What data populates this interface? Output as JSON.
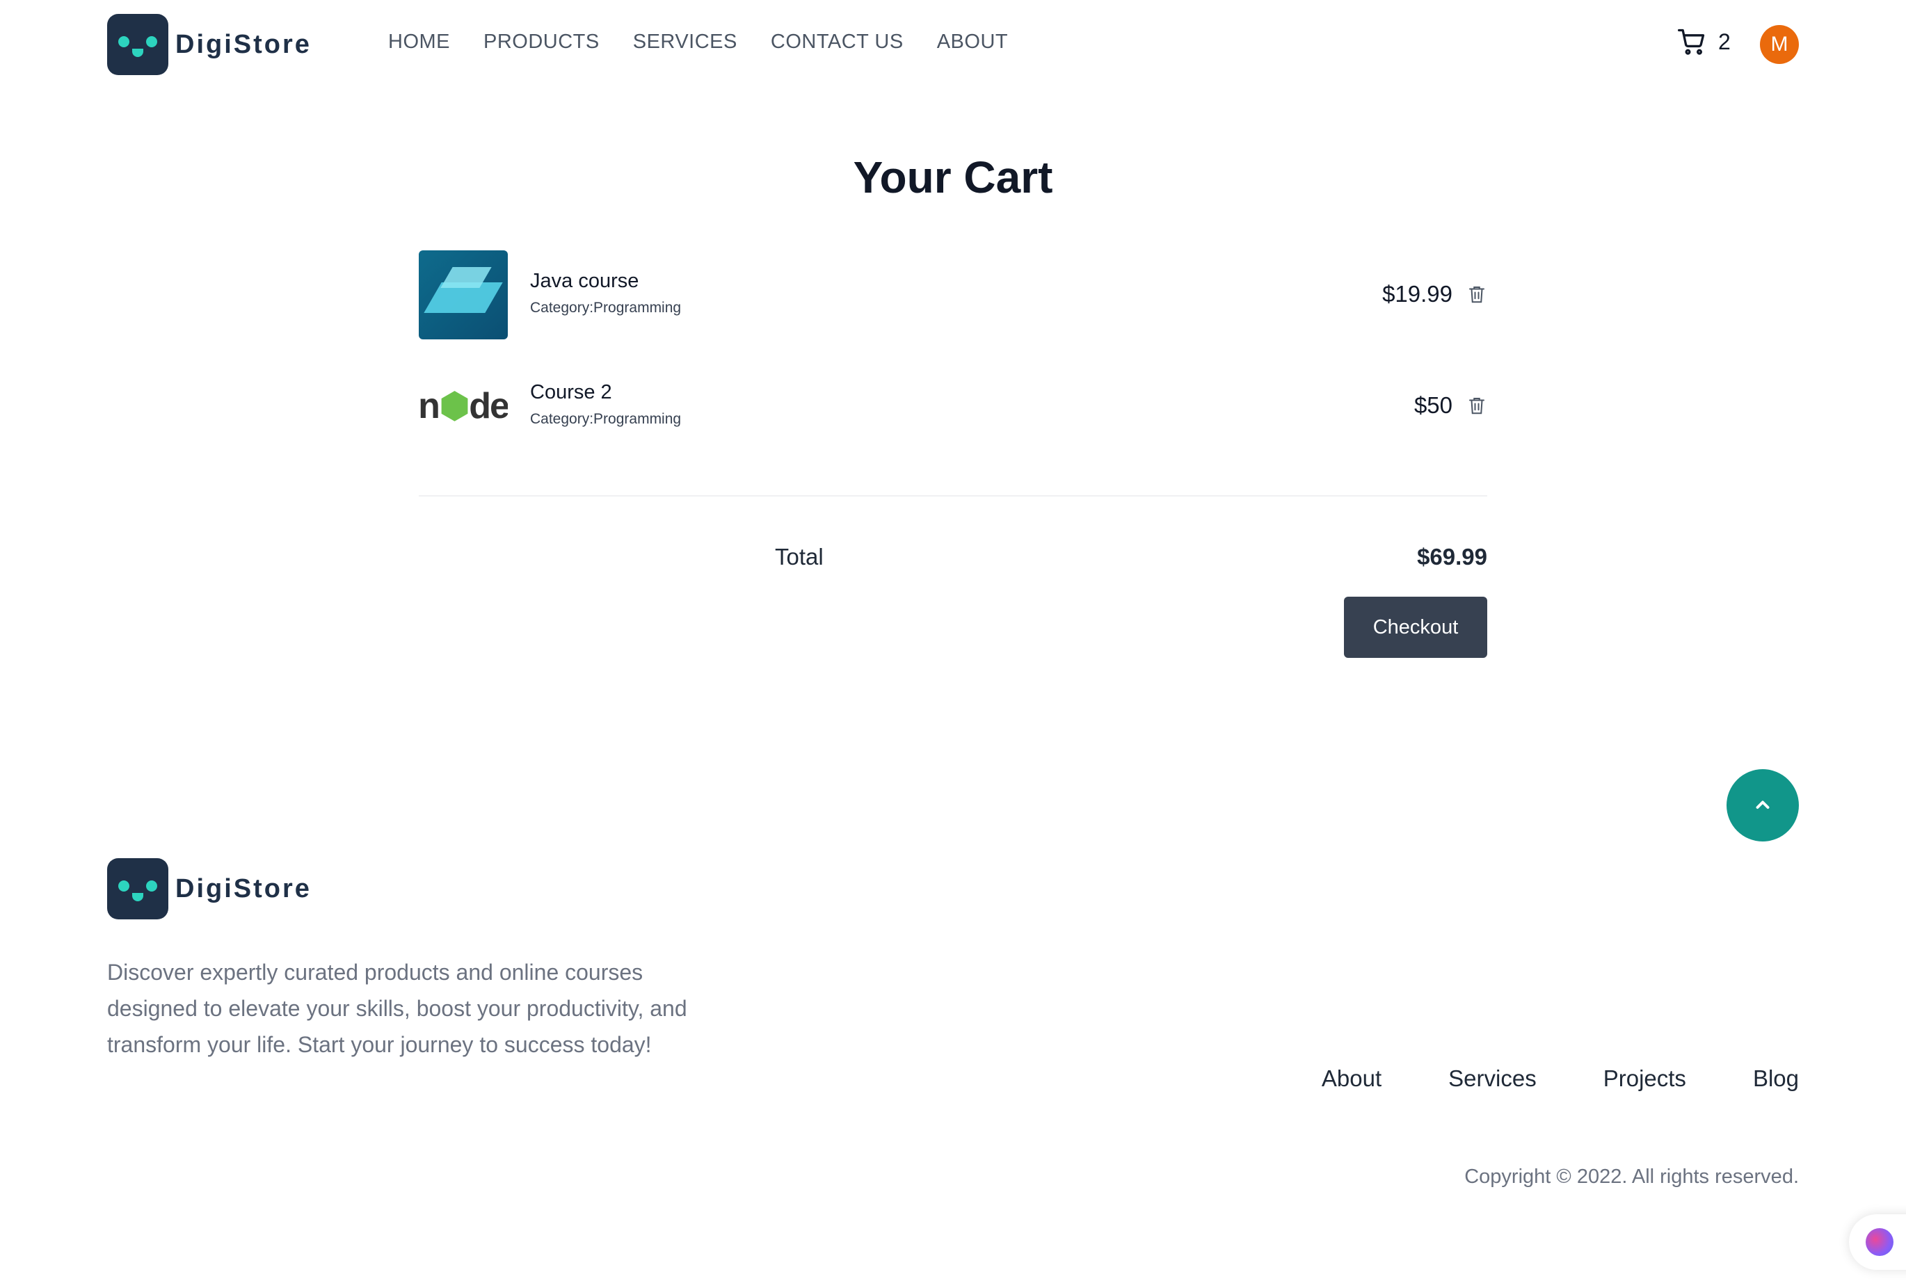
{
  "brand": {
    "name": "DigiStore",
    "accent": "#2dd4bf",
    "dark": "#1f3047"
  },
  "nav": {
    "items": [
      "HOME",
      "PRODUCTS",
      "SERVICES",
      "CONTACT US",
      "ABOUT"
    ]
  },
  "cart_indicator": {
    "count": "2"
  },
  "user": {
    "initial": "M",
    "color": "#ea6a0c"
  },
  "page": {
    "title": "Your Cart"
  },
  "cart": {
    "items": [
      {
        "name": "Java course",
        "category": "Category:Programming",
        "price": "$19.99",
        "thumbnail": "java-isometric-illustration"
      },
      {
        "name": "Course 2",
        "category": "Category:Programming",
        "price": "$50",
        "thumbnail": "nodejs-logo"
      }
    ],
    "total_label": "Total",
    "total_value": "$69.99",
    "checkout_label": "Checkout"
  },
  "scroll_top": {
    "icon": "chevron-up-icon",
    "color": "#11968a"
  },
  "footer": {
    "description": "Discover expertly curated products and online courses designed to elevate your skills, boost your productivity, and transform your life. Start your journey to success today!",
    "links": [
      "About",
      "Services",
      "Projects",
      "Blog"
    ],
    "copyright": "Copyright © 2022. All rights reserved."
  },
  "assistant_widget": {
    "icon": "brain-icon"
  }
}
